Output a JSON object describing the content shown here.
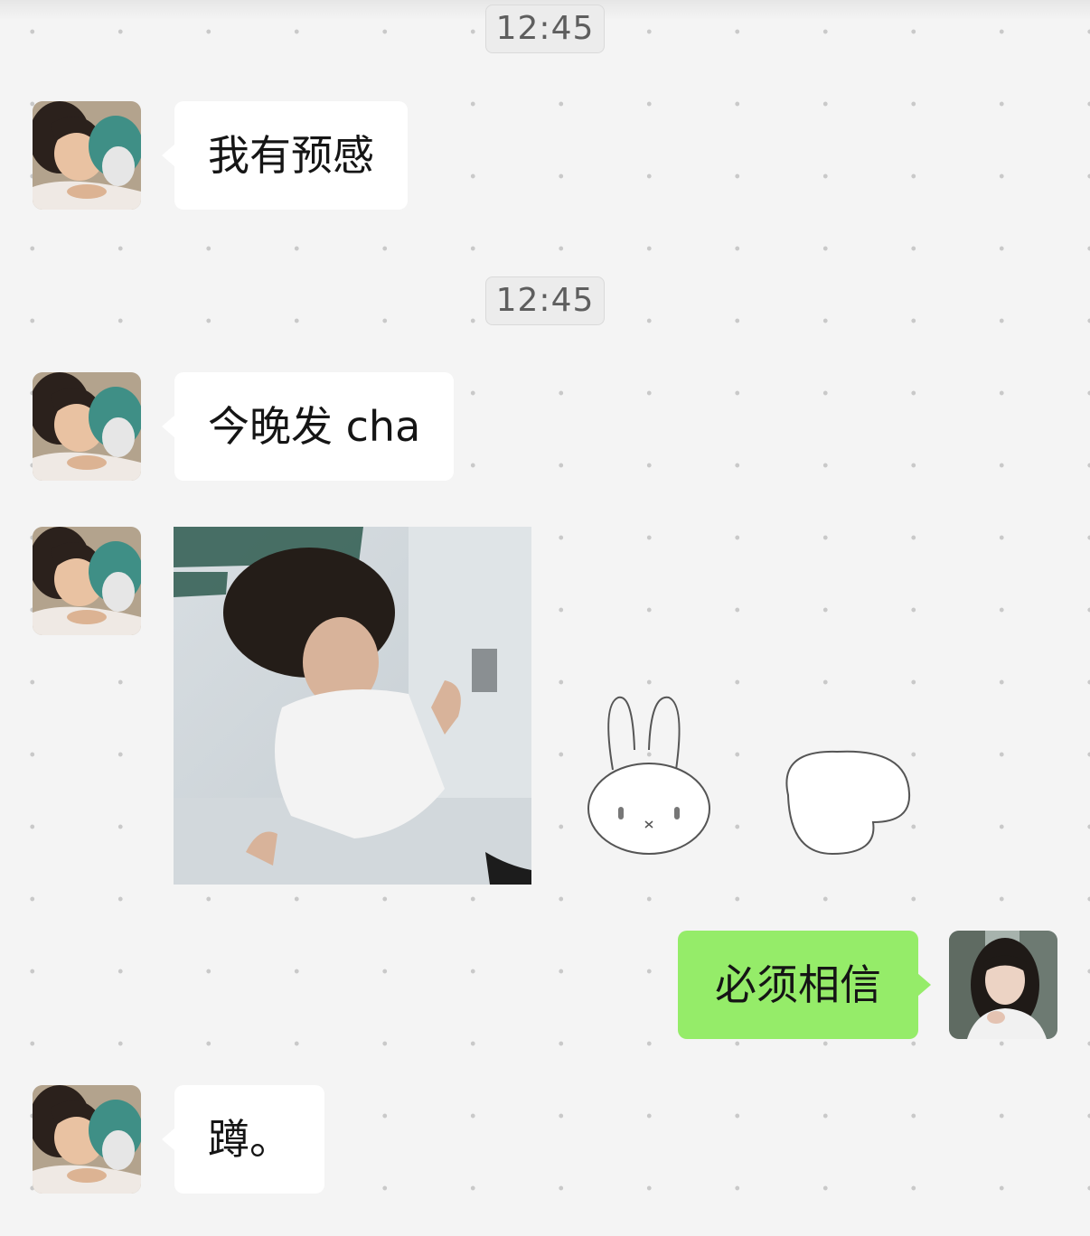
{
  "chat": {
    "timestamps": [
      "12:45",
      "12:45"
    ],
    "messages": [
      {
        "sender": "contact",
        "type": "text",
        "text": "我有预感"
      },
      {
        "sender": "contact",
        "type": "text",
        "text": "今晚发 cha"
      },
      {
        "sender": "contact",
        "type": "sticker",
        "sticker": "animated photo sticker with rabbit doodle"
      },
      {
        "sender": "me",
        "type": "text",
        "text": "必须相信"
      },
      {
        "sender": "contact",
        "type": "text",
        "text": "蹲。"
      }
    ]
  },
  "colors": {
    "background": "#f4f4f4",
    "incoming_bubble": "#ffffff",
    "outgoing_bubble": "#95ec69",
    "timestamp_text": "#5e5e5e"
  },
  "icons": {
    "contact_avatar": "child-avatar",
    "my_avatar": "girl-avatar",
    "sticker": "photo-sticker",
    "doodle": "rabbit-doodle"
  }
}
